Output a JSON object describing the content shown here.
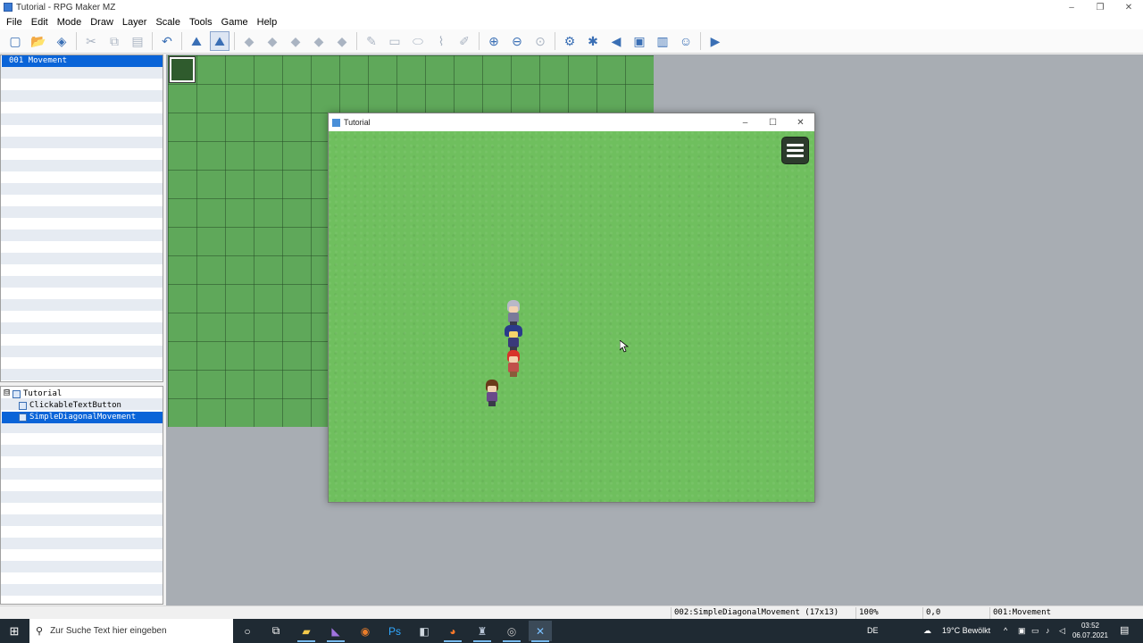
{
  "window": {
    "title": "Tutorial - RPG Maker MZ",
    "controls": [
      "–",
      "❐",
      "✕"
    ]
  },
  "menubar": [
    "File",
    "Edit",
    "Mode",
    "Draw",
    "Layer",
    "Scale",
    "Tools",
    "Game",
    "Help"
  ],
  "toolbar": {
    "icons": [
      "new-project-icon",
      "open-project-icon",
      "save-project-icon",
      "cut-icon",
      "copy-icon",
      "paste-icon",
      "undo-icon",
      "map-mode-icon",
      "event-mode-icon",
      "layer-a-icon",
      "layer-b-icon",
      "layer-c-icon",
      "layer-d-icon",
      "layer-e-icon",
      "pencil-icon",
      "rectangle-icon",
      "ellipse-icon",
      "flood-fill-icon",
      "shadow-pen-icon",
      "zoom-in-icon",
      "zoom-out-icon",
      "zoom-actual-icon",
      "database-icon",
      "plugin-manager-icon",
      "sound-test-icon",
      "event-searcher-icon",
      "resource-manager-icon",
      "character-generator-icon",
      "playtest-icon"
    ],
    "active_icon": "event-mode-icon"
  },
  "map_list": {
    "selected": "001 Movement"
  },
  "tree": {
    "root": "Tutorial",
    "expander": "⊟",
    "items": [
      "ClickableTextButton",
      "SimpleDiagonalMovement"
    ],
    "selected": "SimpleDiagonalMovement"
  },
  "game_window": {
    "title": "Tutorial",
    "controls": [
      "–",
      "☐",
      "✕"
    ],
    "menu_icon": "hamburger-menu-icon"
  },
  "statusbar": {
    "map_info": "002:SimpleDiagonalMovement (17x13)",
    "zoom": "100%",
    "coords": "0,0",
    "map_name": "001:Movement"
  },
  "taskbar": {
    "search_placeholder": "Zur Suche Text hier eingeben",
    "icons": [
      "cortana-icon",
      "task-view-icon",
      "file-explorer-icon",
      "visual-studio-icon",
      "blender-icon",
      "photoshop-icon",
      "vscode-small-icon",
      "firefox-icon",
      "rpg-maker-icon",
      "obs-icon",
      "vscode-icon"
    ],
    "language": "DE",
    "weather": "19°C  Bewölkt",
    "time": "03:52",
    "date": "06.07.2021",
    "colors": {
      "taskbar": "#1f2a33",
      "accent": "#76b9ed",
      "selection": "#0a64d8"
    }
  }
}
